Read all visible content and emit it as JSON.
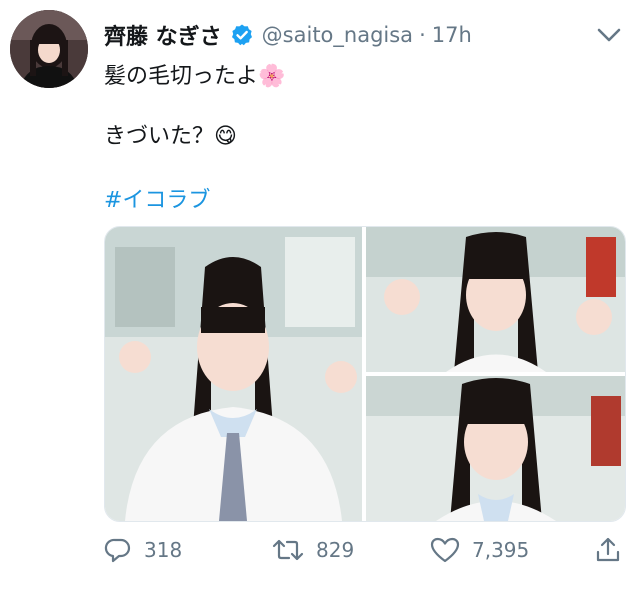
{
  "tweet": {
    "author_name": "齊藤 なぎさ",
    "author_handle": "@saito_nagisa",
    "separator": "·",
    "time": "17h",
    "line1": "髪の毛切ったよ",
    "line1_emoji": "🌸",
    "line2": "きづいた？",
    "line2_emoji": "😋",
    "hashtag": "#イコラブ"
  },
  "actions": {
    "reply_count": "318",
    "retweet_count": "829",
    "like_count": "7,395"
  },
  "colors": {
    "accent": "#1b95e0",
    "muted": "#657786",
    "verified": "#1da1f2"
  },
  "icons": [
    "verified-badge-icon",
    "chevron-down-icon",
    "reply-icon",
    "retweet-icon",
    "like-icon",
    "share-icon"
  ]
}
